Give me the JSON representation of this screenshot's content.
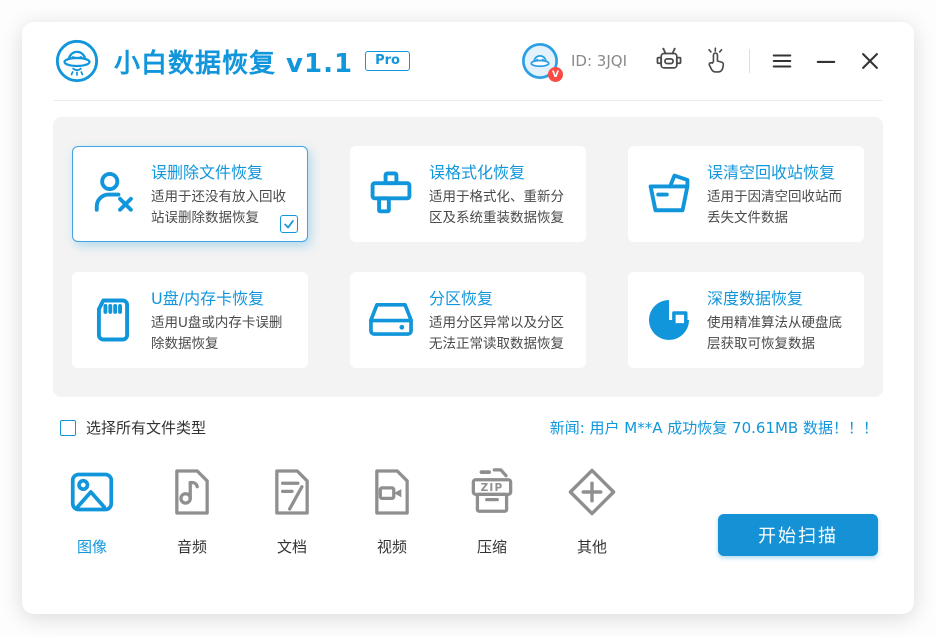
{
  "colors": {
    "primary": "#1296db",
    "button_blue": "#1591d5",
    "badge_red": "#f94b43",
    "panel_gray": "#f3f3f3",
    "icon_gray": "#8f8f8f",
    "text_dark": "#4a4a4a"
  },
  "header": {
    "app_title": "小白数据恢复 v1.1",
    "badge": "Pro",
    "avatar_badge": "V",
    "user_id": "ID: 3JQI",
    "icons": [
      "alien-logo",
      "avatar",
      "robot-icon",
      "pointer-hand-icon",
      "menu-icon",
      "minimize-icon",
      "close-icon"
    ]
  },
  "recovery_modes": [
    {
      "title": "误删除文件恢复",
      "desc": "适用于还没有放入回收站误删除数据恢复",
      "icon": "user-delete-icon",
      "selected": true
    },
    {
      "title": "误格式化恢复",
      "desc": "适用于格式化、重新分区及系统重装数据恢复",
      "icon": "format-stamp-icon",
      "selected": false
    },
    {
      "title": "误清空回收站恢复",
      "desc": "适用于因清空回收站而丢失文件数据",
      "icon": "recycle-basket-icon",
      "selected": false
    },
    {
      "title": "U盘/内存卡恢复",
      "desc": "适用U盘或内存卡误删除数据恢复",
      "icon": "sd-card-icon",
      "selected": false
    },
    {
      "title": "分区恢复",
      "desc": "适用分区异常以及分区无法正常读取数据恢复",
      "icon": "hard-drive-icon",
      "selected": false
    },
    {
      "title": "深度数据恢复",
      "desc": "使用精准算法从硬盘底层获取可恢复数据",
      "icon": "deep-scan-icon",
      "selected": false
    }
  ],
  "select_all": {
    "label": "选择所有文件类型",
    "checked": false
  },
  "news": {
    "text": "新闻: 用户 M**A 成功恢复 70.61MB 数据！！！"
  },
  "file_types": [
    {
      "label": "图像",
      "icon": "image-file-icon",
      "active": true
    },
    {
      "label": "音频",
      "icon": "audio-file-icon",
      "active": false
    },
    {
      "label": "文档",
      "icon": "document-file-icon",
      "active": false
    },
    {
      "label": "视频",
      "icon": "video-file-icon",
      "active": false
    },
    {
      "label": "压缩",
      "icon": "zip-file-icon",
      "icon_text": "ZIP",
      "active": false
    },
    {
      "label": "其他",
      "icon": "other-file-icon",
      "active": false
    }
  ],
  "scan_button": {
    "label": "开始扫描"
  }
}
